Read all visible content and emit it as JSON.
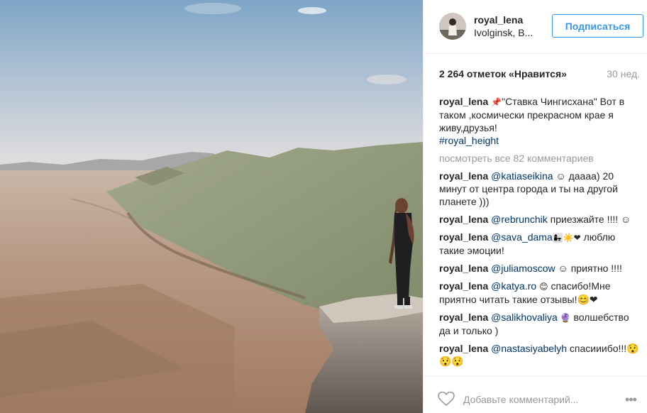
{
  "header": {
    "username": "royal_lena",
    "location": "Ivolginsk, B...",
    "follow_label": "Подписаться"
  },
  "stats": {
    "likes": "2 264 отметок «Нравится»",
    "date": "30 нед."
  },
  "caption": {
    "author": "royal_lena",
    "pin_icon": "pushpin-icon",
    "text": "\"Ставка Чингисхана\" Вот в таком ,космически прекрасном крае я живу,друзья!",
    "hashtag": "#royal_height"
  },
  "view_all": "посмотреть все 82 комментариев",
  "comments": [
    {
      "author": "royal_lena",
      "mention": "@katiaseikina",
      "text": "☺ даааа) 20 минут от центра города и ты на другой планете )))"
    },
    {
      "author": "royal_lena",
      "mention": "@rebrunchik",
      "text": "приезжайте !!!! ☺"
    },
    {
      "author": "royal_lena",
      "mention": "@sava_dama",
      "emoji": "👩‍👧☀️❤",
      "text": "люблю такие эмоции!"
    },
    {
      "author": "royal_lena",
      "mention": "@juliamoscow",
      "text": "☺ приятно !!!!"
    },
    {
      "author": "royal_lena",
      "mention": "@katya.ro",
      "emoji": "😊",
      "text": "спасибо!Мне приятно читать такие отзывы!😊❤"
    },
    {
      "author": "royal_lena",
      "mention": "@salikhovaliya",
      "emoji": "🔮",
      "text": "волшебство да и только )"
    },
    {
      "author": "royal_lena",
      "mention": "@nastasiyabelyh",
      "text": "спасииибо!!!😯😯😯"
    }
  ],
  "add_comment": {
    "placeholder": "Добавьте комментарий...",
    "heart_icon": "heart-outline-icon",
    "more_icon": "ellipsis-icon"
  },
  "colors": {
    "accent": "#3897f0",
    "link": "#003569",
    "muted": "#999999"
  }
}
